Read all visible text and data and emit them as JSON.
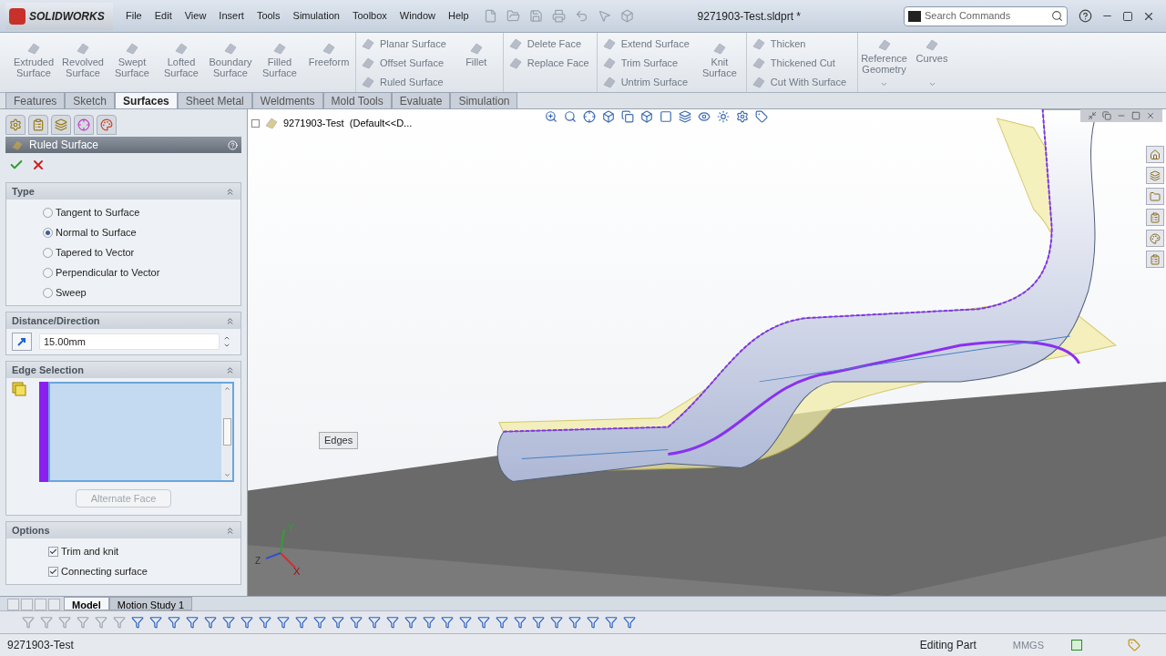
{
  "app": {
    "name": "SOLIDWORKS"
  },
  "menu": [
    "File",
    "Edit",
    "View",
    "Insert",
    "Tools",
    "Simulation",
    "Toolbox",
    "Window",
    "Help"
  ],
  "document_title": "9271903-Test.sldprt *",
  "search": {
    "placeholder": "Search Commands"
  },
  "ribbon": [
    {
      "kind": "large",
      "label": "Extruded Surface"
    },
    {
      "kind": "large",
      "label": "Revolved Surface"
    },
    {
      "kind": "large",
      "label": "Swept Surface"
    },
    {
      "kind": "large",
      "label": "Lofted Surface"
    },
    {
      "kind": "large",
      "label": "Boundary Surface"
    },
    {
      "kind": "large",
      "label": "Filled Surface"
    },
    {
      "kind": "large",
      "label": "Freeform"
    },
    {
      "kind": "stack",
      "items": [
        "Planar Surface",
        "Offset Surface",
        "Ruled Surface"
      ]
    },
    {
      "kind": "large",
      "label": "Fillet"
    },
    {
      "kind": "stack",
      "items": [
        "Delete Face",
        "Replace Face"
      ]
    },
    {
      "kind": "stack",
      "items": [
        "Extend Surface",
        "Trim Surface",
        "Untrim Surface"
      ]
    },
    {
      "kind": "large",
      "label": "Knit Surface"
    },
    {
      "kind": "stack",
      "items": [
        "Thicken",
        "Thickened Cut",
        "Cut With Surface"
      ]
    },
    {
      "kind": "menu",
      "label": "Reference Geometry"
    },
    {
      "kind": "menu",
      "label": "Curves"
    }
  ],
  "tabs": [
    {
      "label": "Features",
      "selected": false
    },
    {
      "label": "Sketch",
      "selected": false
    },
    {
      "label": "Surfaces",
      "selected": true
    },
    {
      "label": "Sheet Metal",
      "selected": false
    },
    {
      "label": "Weldments",
      "selected": false
    },
    {
      "label": "Mold Tools",
      "selected": false
    },
    {
      "label": "Evaluate",
      "selected": false
    },
    {
      "label": "Simulation",
      "selected": false
    }
  ],
  "property_manager": {
    "title": "Ruled Surface",
    "type_header": "Type",
    "type_options": [
      {
        "label": "Tangent to Surface",
        "selected": false
      },
      {
        "label": "Normal to Surface",
        "selected": true
      },
      {
        "label": "Tapered to Vector",
        "selected": false
      },
      {
        "label": "Perpendicular to Vector",
        "selected": false
      },
      {
        "label": "Sweep",
        "selected": false
      }
    ],
    "distance_header": "Distance/Direction",
    "distance": "15.00mm",
    "edge_header": "Edge Selection",
    "alternate_face": {
      "label": "Alternate Face",
      "disabled": true
    },
    "options_header": "Options",
    "options": [
      {
        "label": "Trim and knit",
        "checked": true
      },
      {
        "label": "Connecting surface",
        "checked": true
      }
    ]
  },
  "tree_root": "9271903-Test  (Default<<D...",
  "callout": "Edges",
  "triad": [
    "X",
    "Y",
    "Z"
  ],
  "bottom_tabs": [
    {
      "label": "Model",
      "selected": true
    },
    {
      "label": "Motion Study 1",
      "selected": false
    }
  ],
  "status_bar": {
    "document": "9271903-Test",
    "mode": "Editing Part",
    "units": {
      "label": "MMGS",
      "disabled": true
    }
  }
}
